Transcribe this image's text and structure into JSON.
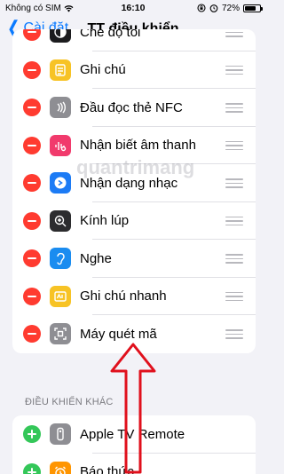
{
  "status_bar": {
    "carrier": "Không có SIM",
    "time": "16:10",
    "battery_text": "72%",
    "battery_level": 0.72
  },
  "nav": {
    "back_label": "Cài đặt",
    "title": "TT điều khiển"
  },
  "included_controls": [
    {
      "label": "Chế độ tối",
      "icon": "dark-mode-icon",
      "color": "#1c1c1e"
    },
    {
      "label": "Ghi chú",
      "icon": "notes-icon",
      "color": "#f7c325"
    },
    {
      "label": "Đầu đọc thẻ NFC",
      "icon": "nfc-icon",
      "color": "#8e8e93"
    },
    {
      "label": "Nhận biết âm thanh",
      "icon": "sound-recognition-icon",
      "color": "#f13a6c"
    },
    {
      "label": "Nhận dạng nhạc",
      "icon": "shazam-icon",
      "color": "#1c7bf5"
    },
    {
      "label": "Kính lúp",
      "icon": "magnifier-icon",
      "color": "#2c2c2e"
    },
    {
      "label": "Nghe",
      "icon": "hearing-icon",
      "color": "#1a8cf0"
    },
    {
      "label": "Ghi chú nhanh",
      "icon": "quick-note-icon",
      "color": "#f7c325"
    },
    {
      "label": "Máy quét mã",
      "icon": "code-scanner-icon",
      "color": "#8e8e93"
    }
  ],
  "more_controls": {
    "header": "ĐIỀU KHIỂN KHÁC",
    "items": [
      {
        "label": "Apple TV Remote",
        "icon": "apple-tv-remote-icon",
        "color": "#8e8e93"
      },
      {
        "label": "Báo thức",
        "icon": "alarm-icon",
        "color": "#ff9500"
      }
    ]
  }
}
